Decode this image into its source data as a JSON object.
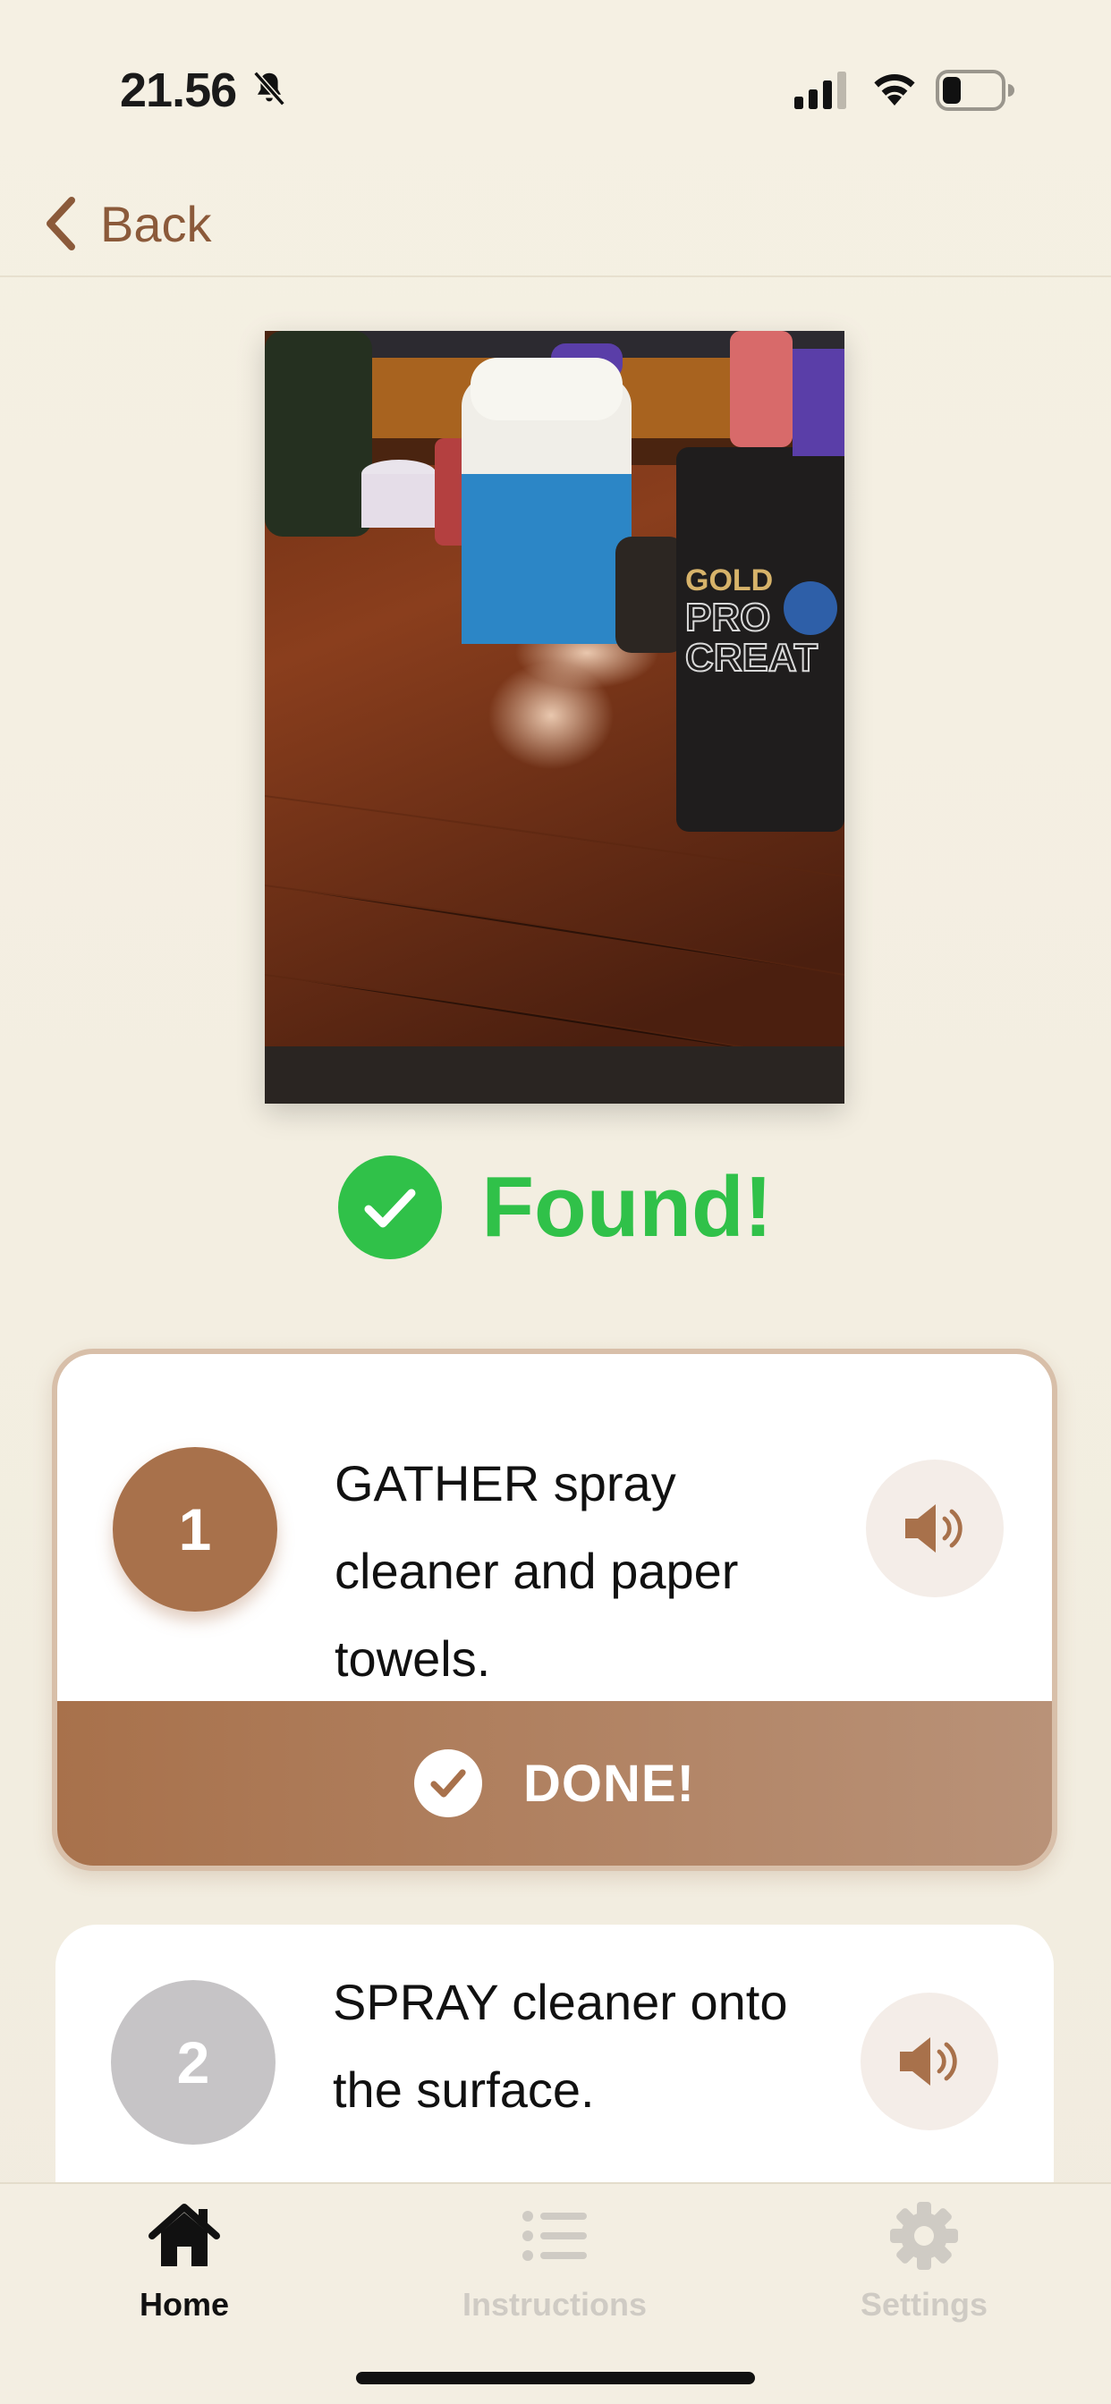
{
  "status_bar": {
    "time": "21.56"
  },
  "nav": {
    "back_label": "Back"
  },
  "result": {
    "found_label": "Found!"
  },
  "steps": [
    {
      "number": "1",
      "text": "GATHER spray cleaner and paper towels.",
      "state": "active",
      "done_label": "DONE!"
    },
    {
      "number": "2",
      "text": "SPRAY cleaner onto the surface.",
      "state": "pending"
    }
  ],
  "tabs": [
    {
      "label": "Home",
      "icon": "house-icon",
      "active": true
    },
    {
      "label": "Instructions",
      "icon": "list-icon",
      "active": false
    },
    {
      "label": "Settings",
      "icon": "gear-icon",
      "active": false
    }
  ],
  "colors": {
    "accent": "#a8714b",
    "success": "#30c149",
    "inactive": "#cfcbc4",
    "background": "#f3eee2"
  }
}
